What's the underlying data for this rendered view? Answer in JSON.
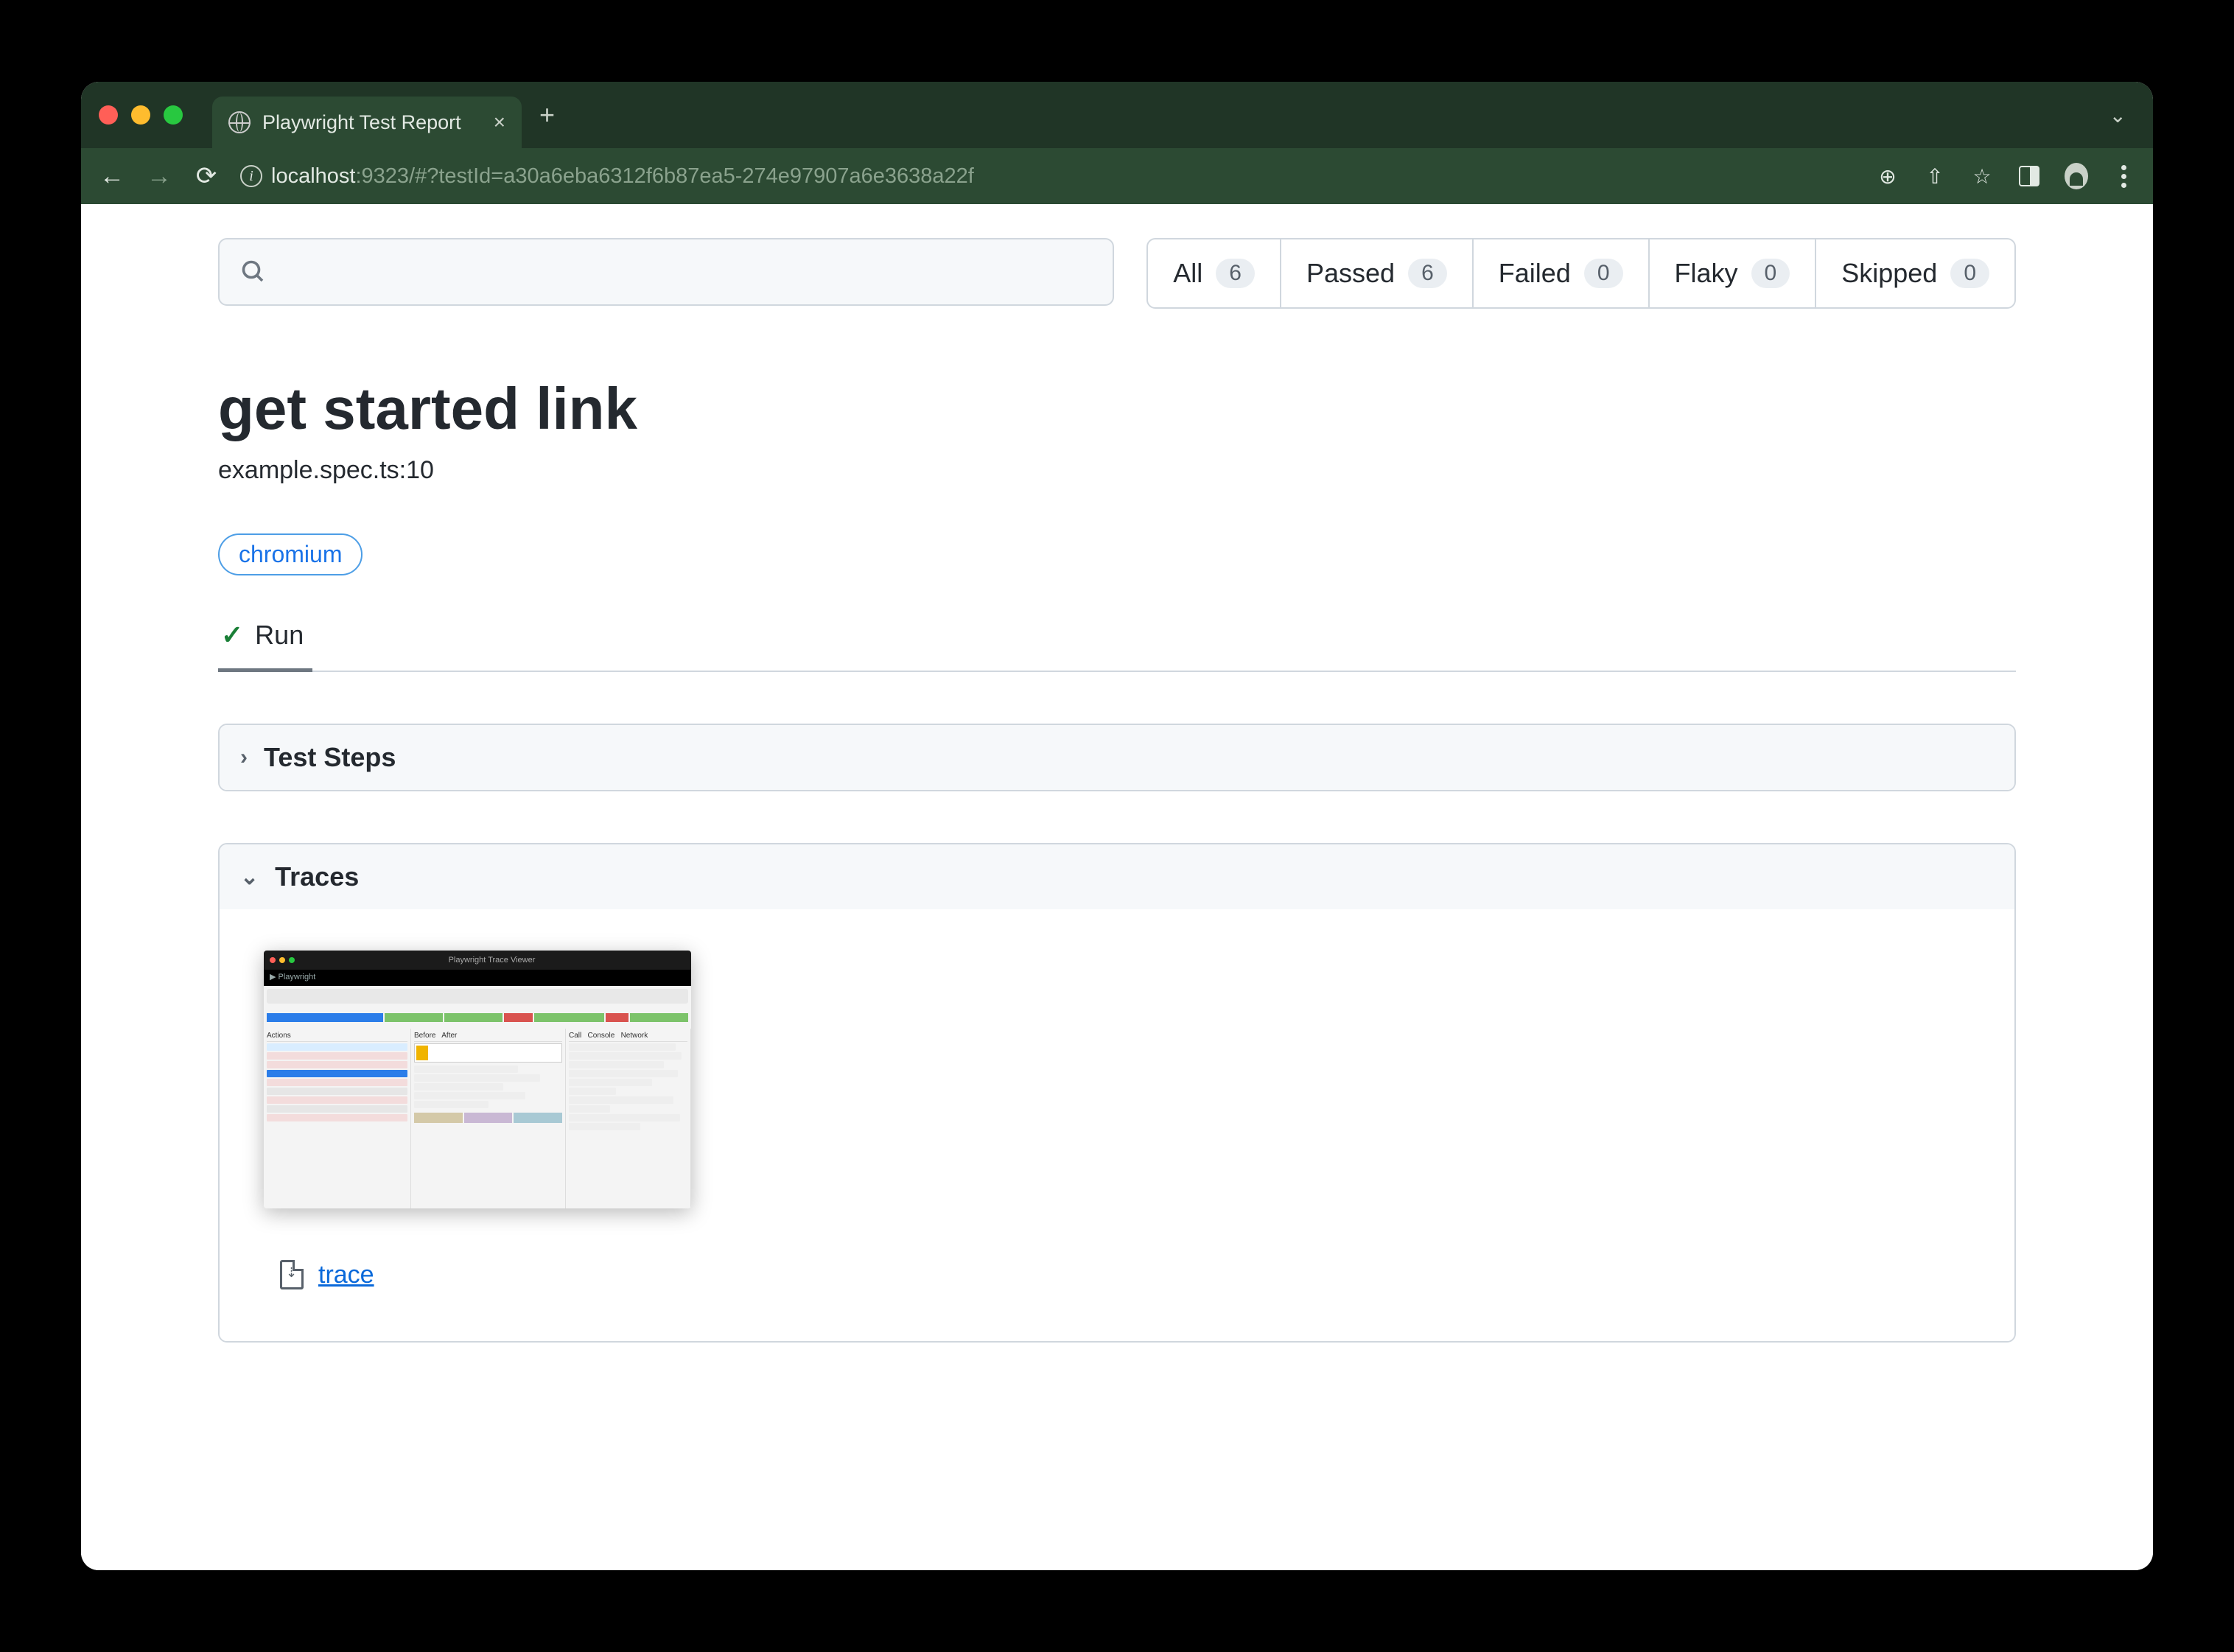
{
  "browser": {
    "tab_title": "Playwright Test Report",
    "url_host": "localhost",
    "url_port_path": ":9323/#?testId=a30a6eba6312f6b87ea5-274e97907a6e3638a22f"
  },
  "filters": {
    "all": {
      "label": "All",
      "count": "6"
    },
    "passed": {
      "label": "Passed",
      "count": "6"
    },
    "failed": {
      "label": "Failed",
      "count": "0"
    },
    "flaky": {
      "label": "Flaky",
      "count": "0"
    },
    "skipped": {
      "label": "Skipped",
      "count": "0"
    }
  },
  "search": {
    "placeholder": ""
  },
  "test": {
    "title": "get started link",
    "location": "example.spec.ts:10",
    "project_tag": "chromium",
    "run_tab": "Run"
  },
  "sections": {
    "steps_title": "Test Steps",
    "traces_title": "Traces",
    "trace_link_label": "trace"
  }
}
